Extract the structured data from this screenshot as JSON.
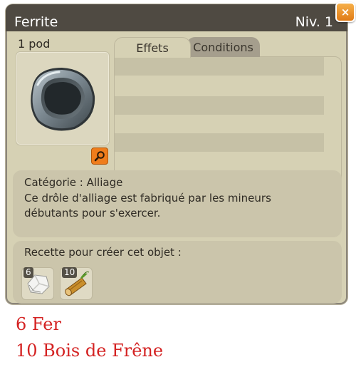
{
  "window": {
    "title": "Ferrite",
    "level": "Niv. 1",
    "close_glyph": "×"
  },
  "item": {
    "weight": "1 pod",
    "icon": "ferrite-ring-icon"
  },
  "tabs": [
    {
      "label": "Effets",
      "active": true
    },
    {
      "label": "Conditions",
      "active": false
    }
  ],
  "description": {
    "category": "Catégorie : Alliage",
    "line1": "Ce drôle d'alliage est fabriqué par les mineurs",
    "line2": "débutants pour s'exercer."
  },
  "recipe": {
    "title": "Recette pour créer cet objet :",
    "ingredients": [
      {
        "count": "6",
        "icon": "fer-ore-icon"
      },
      {
        "count": "10",
        "icon": "bois-de-frene-log-icon"
      }
    ]
  },
  "caption": {
    "line1": "6 Fer",
    "line2": "10 Bois de Frêne"
  },
  "colors": {
    "window_bg": "#d6d1b4",
    "titlebar": "#4f4a42",
    "close_button": "#e07b16",
    "caption_text": "#d42222"
  }
}
